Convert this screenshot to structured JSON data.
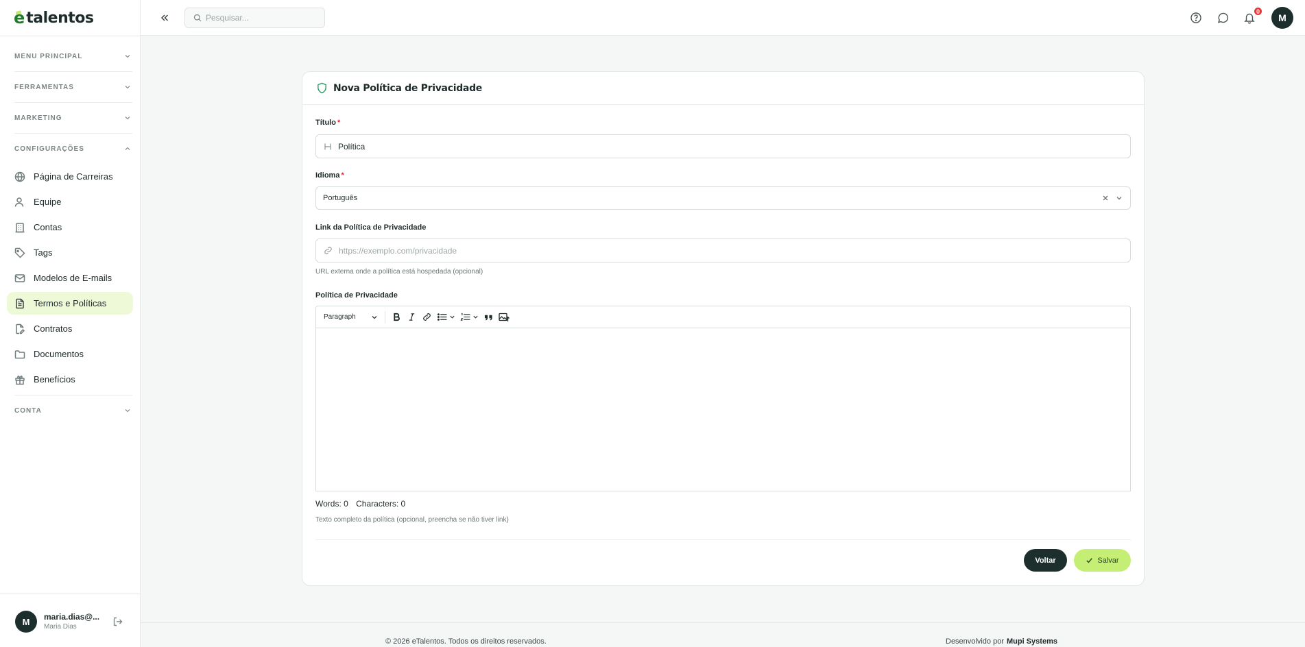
{
  "brand": {
    "name": "talentos",
    "mark": "e"
  },
  "sidebar": {
    "sections": [
      {
        "label": "MENU PRINCIPAL",
        "expanded": false
      },
      {
        "label": "FERRAMENTAS",
        "expanded": false
      },
      {
        "label": "MARKETING",
        "expanded": false
      },
      {
        "label": "CONFIGURAÇÕES",
        "expanded": true
      },
      {
        "label": "CONTA",
        "expanded": false
      }
    ],
    "items": [
      {
        "label": "Página de Carreiras",
        "icon": "globe-icon"
      },
      {
        "label": "Equipe",
        "icon": "user-icon"
      },
      {
        "label": "Contas",
        "icon": "building-icon"
      },
      {
        "label": "Tags",
        "icon": "tag-icon"
      },
      {
        "label": "Modelos de E-mails",
        "icon": "mail-icon"
      },
      {
        "label": "Termos e Políticas",
        "icon": "file-text-icon",
        "active": true
      },
      {
        "label": "Contratos",
        "icon": "file-signature-icon"
      },
      {
        "label": "Documentos",
        "icon": "folder-icon"
      },
      {
        "label": "Benefícios",
        "icon": "gift-icon"
      }
    ],
    "user": {
      "initial": "M",
      "email": "maria.dias@...",
      "name": "Maria Dias"
    }
  },
  "header": {
    "search_placeholder": "Pesquisar...",
    "notifications_count": "0",
    "avatar_initial": "M"
  },
  "form": {
    "title": "Nova Política de Privacidade",
    "titulo_label": "Título",
    "titulo_value": "Política",
    "idioma_label": "Idioma",
    "idioma_value": "Português",
    "link_label": "Link da Política de Privacidade",
    "link_placeholder": "https://exemplo.com/privacidade",
    "link_help": "URL externa onde a política está hospedada (opcional)",
    "policy_label": "Política de Privacidade",
    "editor": {
      "paragraph_label": "Paragraph",
      "words": "Words: 0",
      "characters": "Characters: 0"
    },
    "policy_help": "Texto completo da política (opcional, preencha se não tiver link)",
    "back_label": "Voltar",
    "save_label": "Salvar"
  },
  "footer": {
    "copyright": "© 2026 eTalentos. Todos os direitos reservados.",
    "dev_prefix": "Desenvolvido por",
    "dev_name": "Mupi Systems"
  },
  "colors": {
    "accent": "#c4ee74",
    "dark": "#1c2f2c",
    "active_bg": "#eef9d8",
    "badge": "#e33333"
  }
}
